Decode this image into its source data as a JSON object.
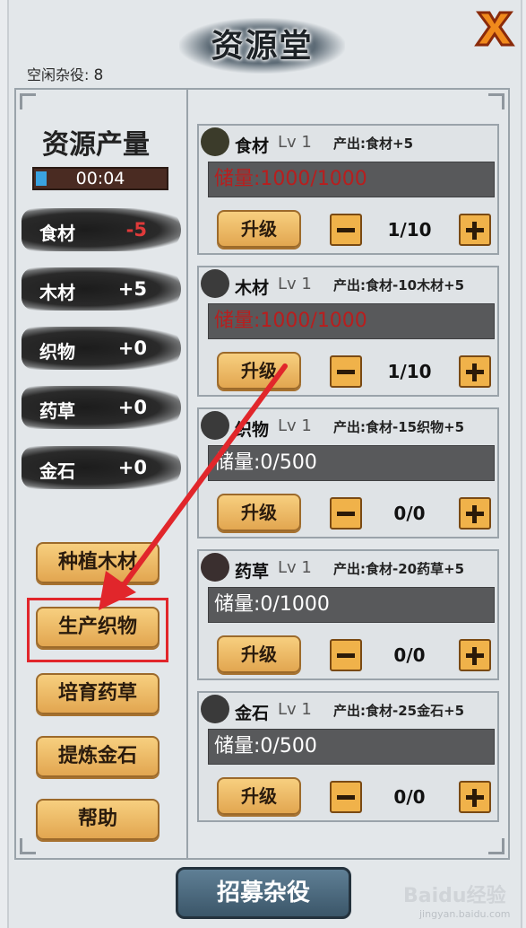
{
  "header": {
    "title": "资源堂",
    "idle_label": "空闲杂役:",
    "idle_count": "8"
  },
  "left": {
    "section_title": "资源产量",
    "timer": "00:04",
    "rates": [
      {
        "name": "食材",
        "value": "-5",
        "color": "#e03a3a"
      },
      {
        "name": "木材",
        "value": "+5",
        "color": "#ffffff"
      },
      {
        "name": "织物",
        "value": "+0",
        "color": "#ffffff"
      },
      {
        "name": "药草",
        "value": "+0",
        "color": "#ffffff"
      },
      {
        "name": "金石",
        "value": "+0",
        "color": "#ffffff"
      }
    ],
    "buttons": [
      "种植木材",
      "生产织物",
      "培育药草",
      "提炼金石",
      "帮助"
    ]
  },
  "cards": [
    {
      "name": "食材",
      "level": "Lv 1",
      "produce": "产出:食材+5",
      "storage": "储量:1000/1000",
      "full": true,
      "upgrade": "升级",
      "count": "1/10"
    },
    {
      "name": "木材",
      "level": "Lv 1",
      "produce": "产出:食材-10木材+5",
      "storage": "储量:1000/1000",
      "full": true,
      "upgrade": "升级",
      "count": "1/10"
    },
    {
      "name": "织物",
      "level": "Lv 1",
      "produce": "产出:食材-15织物+5",
      "storage": "储量:0/500",
      "full": false,
      "upgrade": "升级",
      "count": "0/0"
    },
    {
      "name": "药草",
      "level": "Lv 1",
      "produce": "产出:食材-20药草+5",
      "storage": "储量:0/1000",
      "full": false,
      "upgrade": "升级",
      "count": "0/0"
    },
    {
      "name": "金石",
      "level": "Lv 1",
      "produce": "产出:食材-25金石+5",
      "storage": "储量:0/500",
      "full": false,
      "upgrade": "升级",
      "count": "0/0"
    }
  ],
  "footer": {
    "recruit": "招募杂役"
  },
  "watermark": {
    "main": "Baidu经验",
    "sub": "jingyan.baidu.com"
  },
  "colors": {
    "annotation": "#e1262b",
    "full_storage": "#b81e1e"
  }
}
